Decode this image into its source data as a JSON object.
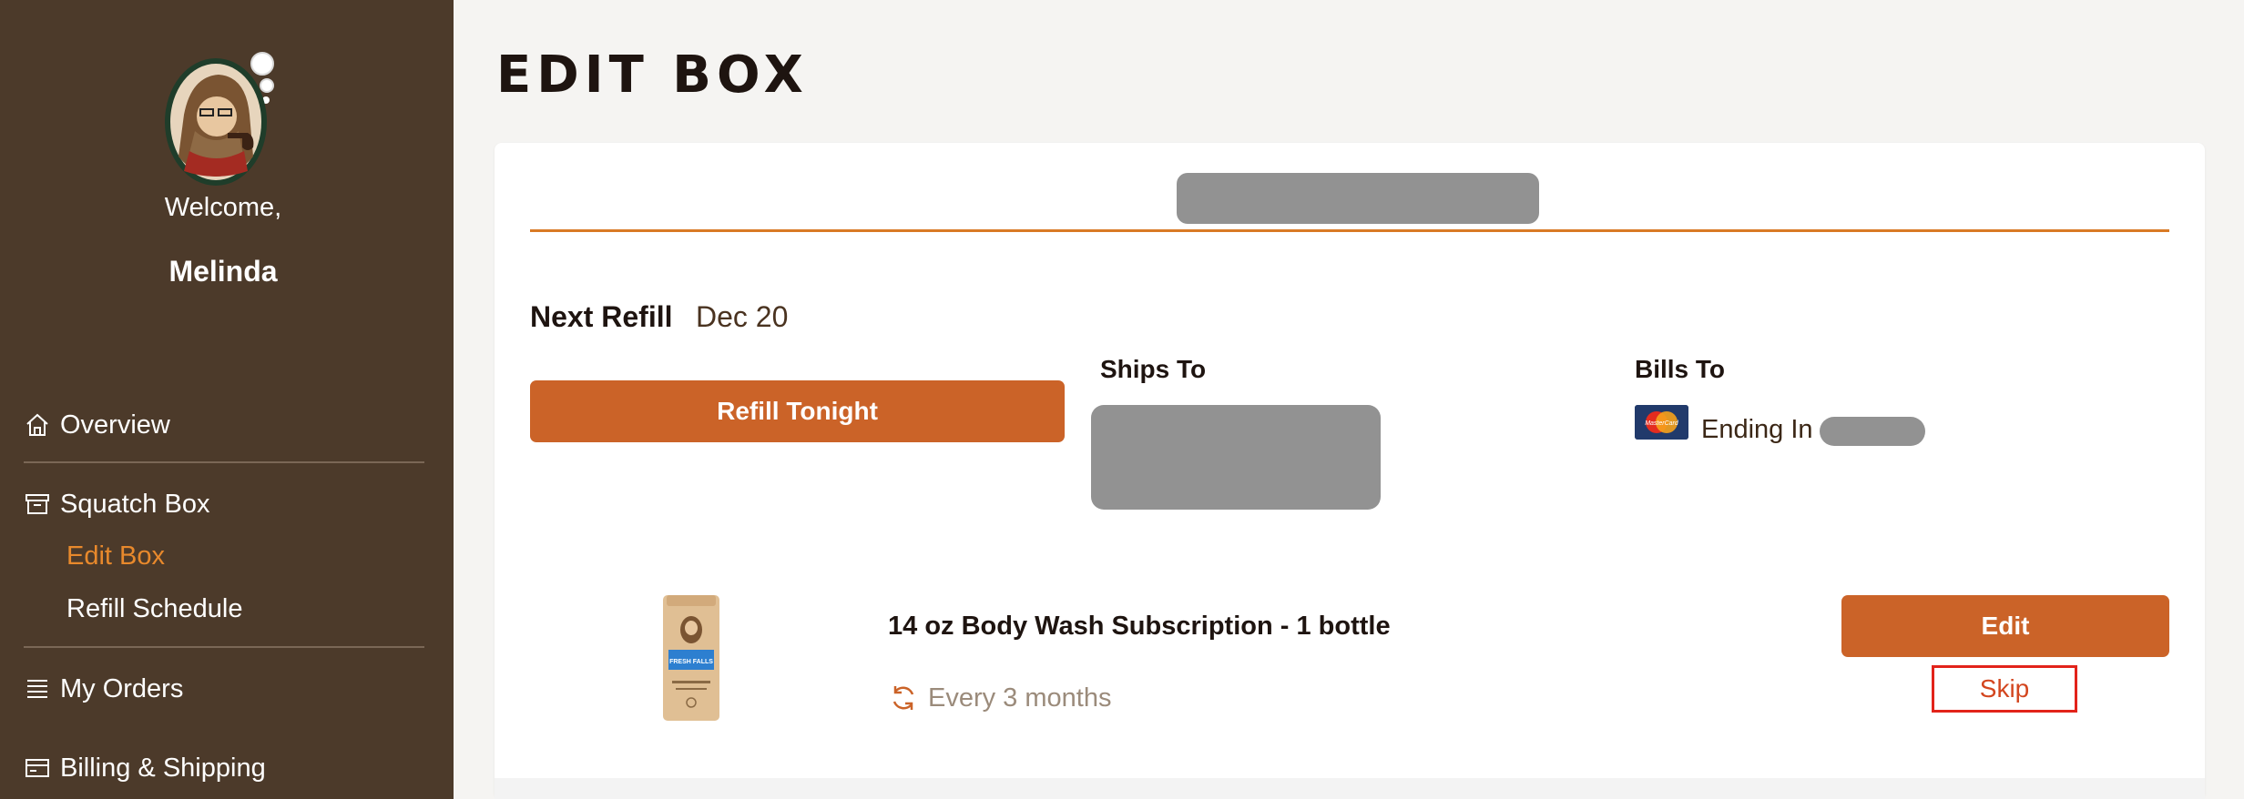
{
  "sidebar": {
    "welcome": "Welcome,",
    "username": "Melinda",
    "nav": {
      "overview": "Overview",
      "squatch_box": "Squatch Box",
      "edit_box": "Edit Box",
      "refill_schedule": "Refill Schedule",
      "my_orders": "My Orders",
      "billing_shipping": "Billing & Shipping"
    }
  },
  "main": {
    "title": "EDIT BOX",
    "next_refill_label": "Next Refill",
    "next_refill_value": "Dec 20",
    "refill_button": "Refill Tonight",
    "ships_to_label": "Ships To",
    "bills_to_label": "Bills To",
    "card_brand_text": "MasterCard",
    "ending_in": "Ending In",
    "product": {
      "title": "14 oz Body Wash Subscription - 1 bottle",
      "frequency": "Every 3 months",
      "label_text": "FRESH FALLS",
      "edit_button": "Edit",
      "skip_link": "Skip"
    }
  },
  "colors": {
    "sidebar_bg": "#4c3a2a",
    "accent_orange": "#cb6328",
    "active_nav": "#e8892c",
    "highlight_red": "#e2231a",
    "redacted": "#929292"
  },
  "icons": {
    "overview": "home-icon",
    "squatch_box": "archive-box-icon",
    "my_orders": "list-icon",
    "billing_shipping": "credit-card-icon",
    "frequency": "refresh-icon"
  }
}
